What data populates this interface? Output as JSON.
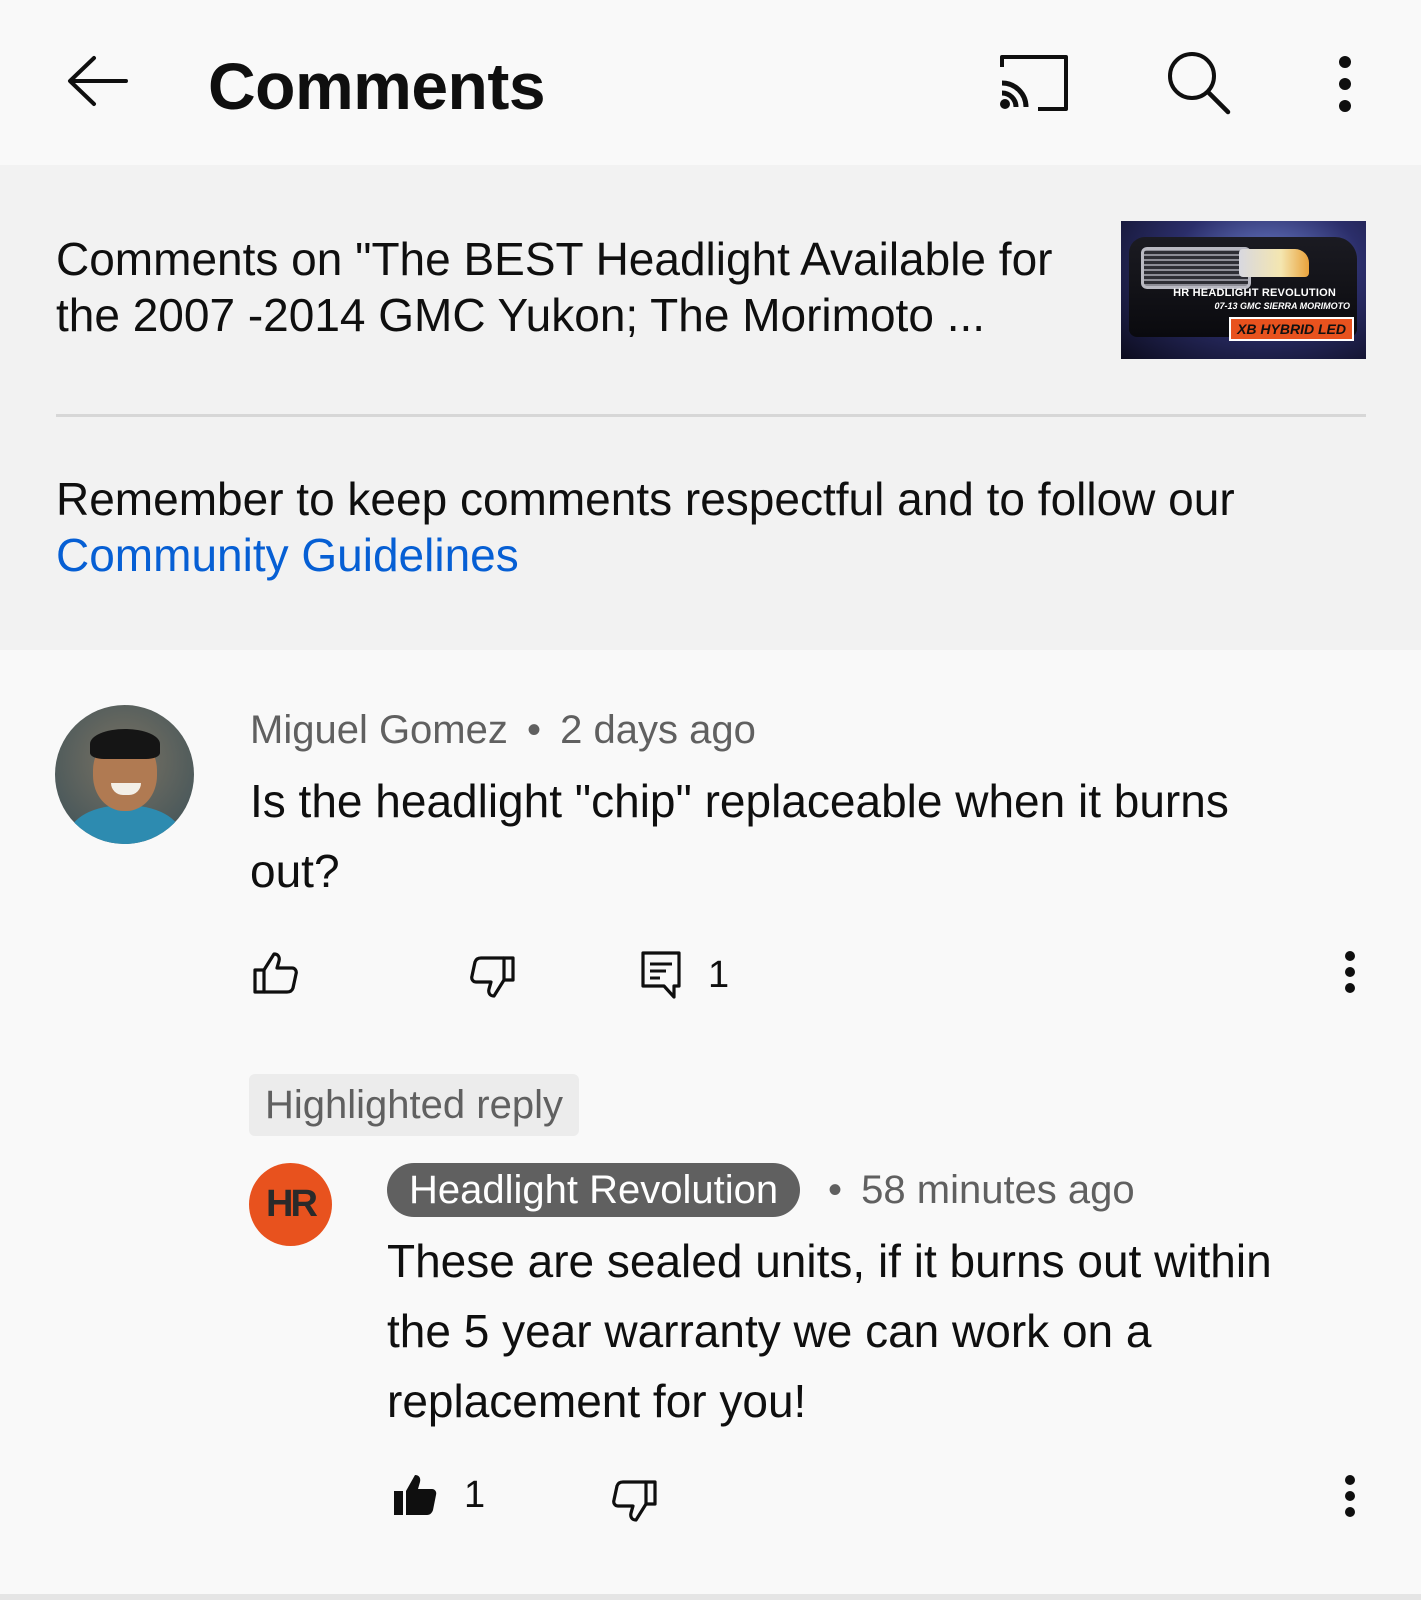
{
  "app": {
    "title": "Comments",
    "icons": {
      "back": "arrow-left-icon",
      "cast": "cast-icon",
      "search": "search-icon",
      "more": "more-vertical-icon"
    }
  },
  "header": {
    "video_title": "Comments on \"The BEST Headlight Available for the 2007 -2014 GMC Yukon; The Morimoto ...",
    "thumbnail": {
      "brand": "HR HEADLIGHT REVOLUTION",
      "caption": "07-13 GMC SIERRA MORIMOTO",
      "badge": "XB HYBRID LED"
    },
    "notice": "Remember to keep comments respectful and to follow our",
    "guidelines_link": "Community Guidelines"
  },
  "comment": {
    "author": "Miguel Gomez",
    "separator": "•",
    "time": "2 days ago",
    "text": "Is the headlight \"chip\" replaceable when it burns out?",
    "reply_count": "1",
    "icons": [
      "thumbs-up-icon",
      "thumbs-down-icon",
      "reply-icon",
      "more-vertical-icon"
    ]
  },
  "highlighted_reply": {
    "label": "Highlighted reply",
    "avatar_text": "HR",
    "author": "Headlight Revolution",
    "separator": "•",
    "time": "58 minutes ago",
    "text": "These are sealed units, if it burns out within the 5 year warranty we can work on a replacement for you!",
    "like_count": "1",
    "icons": [
      "thumbs-up-filled-icon",
      "thumbs-down-icon",
      "more-vertical-icon"
    ]
  },
  "colors": {
    "background": "#f9f9f9",
    "panel": "#f2f2f2",
    "link": "#065fd4",
    "secondary_text": "#606060",
    "brand_orange": "#e8521e"
  }
}
